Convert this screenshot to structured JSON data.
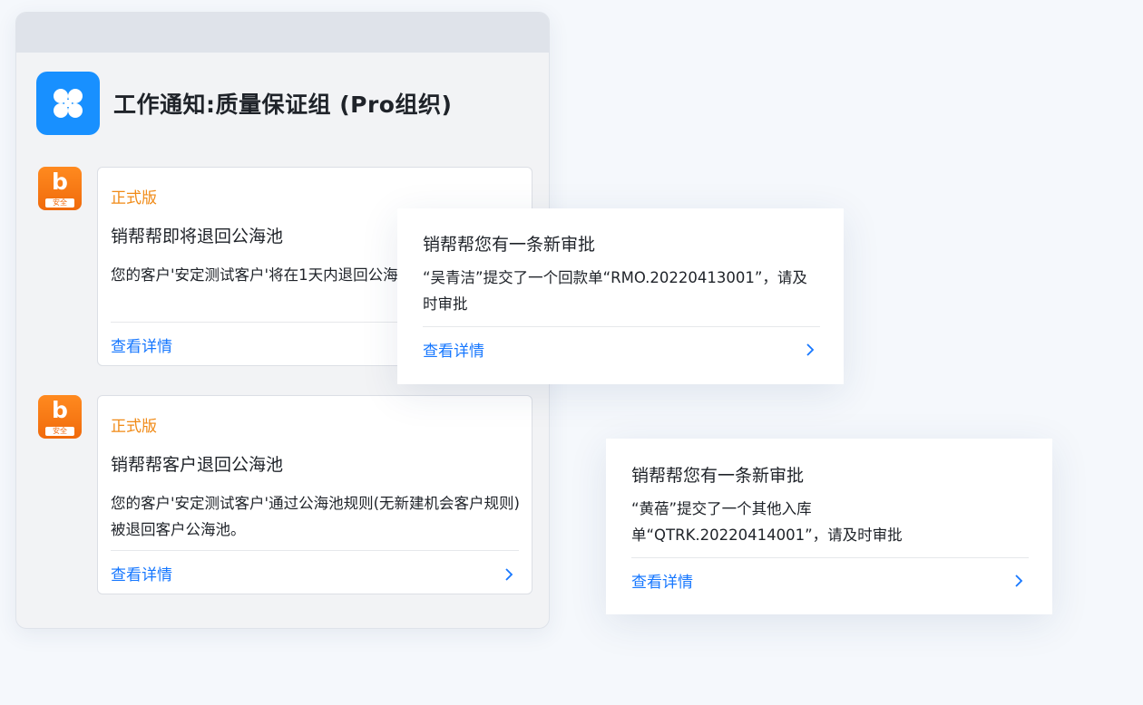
{
  "panel": {
    "title": "工作通知:质量保证组 (Pro组织)"
  },
  "bot": {
    "letter": "b",
    "tag": "安全"
  },
  "cards": [
    {
      "version": "正式版",
      "title": "销帮帮即将退回公海池",
      "body": "您的客户'安定测试客户'将在1天内退回公海池，请及时跟进。",
      "link": "查看详情"
    },
    {
      "version": "正式版",
      "title": "销帮帮客户退回公海池",
      "body": "您的客户'安定测试客户'通过公海池规则(无新建机会客户规则)被退回客户公海池。",
      "link": "查看详情"
    }
  ],
  "approvals": [
    {
      "title": "销帮帮您有一条新审批",
      "body": "“吴青洁”提交了一个回款单“RMO.20220413001”，请及时审批",
      "link": "查看详情"
    },
    {
      "title": "销帮帮您有一条新审批",
      "body": "“黄蓓”提交了一个其他入库单“QTRK.20220414001”，请及时审批",
      "link": "查看详情"
    }
  ],
  "colors": {
    "accent": "#1677ff",
    "version": "#f08a16",
    "app_icon": "#1890ff",
    "bot_icon": "#f06a0c"
  }
}
